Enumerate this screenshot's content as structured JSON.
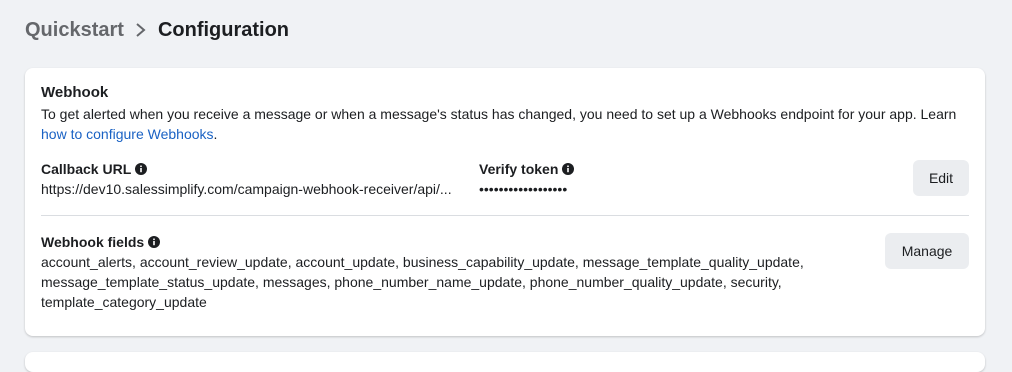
{
  "breadcrumb": {
    "root": "Quickstart",
    "current": "Configuration"
  },
  "webhook": {
    "title": "Webhook",
    "description": "To get alerted when you receive a message or when a message's status has changed, you need to set up a Webhooks endpoint for your app. Learn ",
    "link_text": "how to configure Webhooks",
    "description_end": ".",
    "callback_label": "Callback URL",
    "callback_value": "https://dev10.salessimplify.com/campaign-webhook-receiver/api/...",
    "verify_label": "Verify token",
    "verify_value": "••••••••••••••••••",
    "edit_label": "Edit",
    "fields_label": "Webhook fields",
    "fields_value": "account_alerts, account_review_update, account_update, business_capability_update, message_template_quality_update, message_template_status_update, messages, phone_number_name_update, phone_number_quality_update, security, template_category_update",
    "manage_label": "Manage"
  },
  "colors": {
    "link": "#1a62c4",
    "background": "#f0f2f5",
    "button_bg": "#ebedf0"
  },
  "icons": {
    "separator": "chevron-right-icon",
    "info": "info-icon"
  }
}
